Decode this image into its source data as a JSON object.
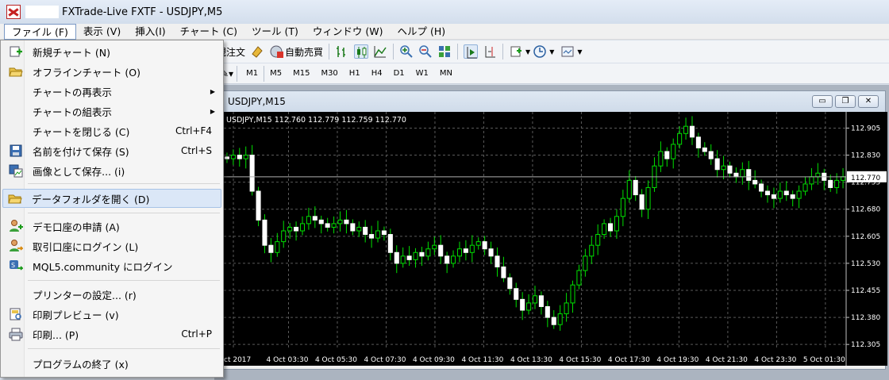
{
  "window": {
    "title": "FXTrade-Live FXTF - USDJPY,M5"
  },
  "menubar": [
    {
      "label": "ファイル (F)"
    },
    {
      "label": "表示 (V)"
    },
    {
      "label": "挿入(I)"
    },
    {
      "label": "チャート (C)"
    },
    {
      "label": "ツール (T)"
    },
    {
      "label": "ウィンドウ (W)"
    },
    {
      "label": "ヘルプ (H)"
    }
  ],
  "toolbar": {
    "new_order_label": "規注文",
    "auto_trade_label": "自動売買"
  },
  "timeframes": [
    "M1",
    "M5",
    "M15",
    "M30",
    "H1",
    "H4",
    "D1",
    "W1",
    "MN"
  ],
  "file_menu": {
    "items": [
      {
        "label": "新規チャート (N)",
        "shortcut": ""
      },
      {
        "label": "オフラインチャート (O)",
        "shortcut": ""
      },
      {
        "label": "チャートの再表示",
        "shortcut": ""
      },
      {
        "label": "チャートの組表示",
        "shortcut": ""
      },
      {
        "label": "チャートを閉じる (C)",
        "shortcut": "Ctrl+F4"
      },
      {
        "label": "名前を付けて保存 (S)",
        "shortcut": "Ctrl+S"
      },
      {
        "label": "画像として保存... (i)",
        "shortcut": ""
      },
      {
        "label": "データフォルダを開く (D)",
        "shortcut": ""
      },
      {
        "label": "デモ口座の申請 (A)",
        "shortcut": ""
      },
      {
        "label": "取引口座にログイン (L)",
        "shortcut": ""
      },
      {
        "label": "MQL5.community にログイン",
        "shortcut": ""
      },
      {
        "label": "プリンターの設定... (r)",
        "shortcut": ""
      },
      {
        "label": "印刷プレビュー (v)",
        "shortcut": ""
      },
      {
        "label": "印刷... (P)",
        "shortcut": "Ctrl+P"
      },
      {
        "label": "プログラムの終了 (x)",
        "shortcut": ""
      }
    ]
  },
  "chart_window": {
    "title": "USDJPY,M15",
    "info": "USDJPY,M15  112.760 112.779 112.759 112.770",
    "current_price": "112.770"
  },
  "chart_data": {
    "type": "candlestick",
    "symbol": "USDJPY",
    "timeframe": "M15",
    "y_ticks": [
      "112.905",
      "112.830",
      "112.755",
      "112.680",
      "112.605",
      "112.530",
      "112.455",
      "112.380",
      "112.305"
    ],
    "x_ticks": [
      "ct 2017",
      "4 Oct 03:30",
      "4 Oct 05:30",
      "4 Oct 07:30",
      "4 Oct 09:30",
      "4 Oct 11:30",
      "4 Oct 13:30",
      "4 Oct 15:30",
      "4 Oct 17:30",
      "4 Oct 19:30",
      "4 Oct 21:30",
      "4 Oct 23:30",
      "5 Oct 01:30"
    ],
    "ylim": [
      112.29,
      112.95
    ],
    "grid": true,
    "price_line": 112.77,
    "closes": [
      112.82,
      112.83,
      112.82,
      112.83,
      112.73,
      112.65,
      112.58,
      112.56,
      112.59,
      112.62,
      112.63,
      112.62,
      112.64,
      112.66,
      112.65,
      112.64,
      112.63,
      112.64,
      112.65,
      112.64,
      112.62,
      112.63,
      112.61,
      112.6,
      112.62,
      112.61,
      112.56,
      112.53,
      112.55,
      112.54,
      112.56,
      112.55,
      112.57,
      112.58,
      112.55,
      112.53,
      112.55,
      112.57,
      112.56,
      112.58,
      112.59,
      112.57,
      112.55,
      112.52,
      112.49,
      112.46,
      112.43,
      112.4,
      112.42,
      112.44,
      112.41,
      112.38,
      112.36,
      112.39,
      112.42,
      112.47,
      112.51,
      112.55,
      112.58,
      112.61,
      112.64,
      112.62,
      112.66,
      112.71,
      112.76,
      112.72,
      112.68,
      112.74,
      112.8,
      112.84,
      112.82,
      112.86,
      112.89,
      112.91,
      112.88,
      112.85,
      112.84,
      112.82,
      112.79,
      112.8,
      112.78,
      112.77,
      112.79,
      112.76,
      112.75,
      112.73,
      112.72,
      112.71,
      112.73,
      112.72,
      112.71,
      112.73,
      112.75,
      112.77,
      112.78,
      112.76,
      112.74,
      112.76,
      112.77
    ]
  }
}
